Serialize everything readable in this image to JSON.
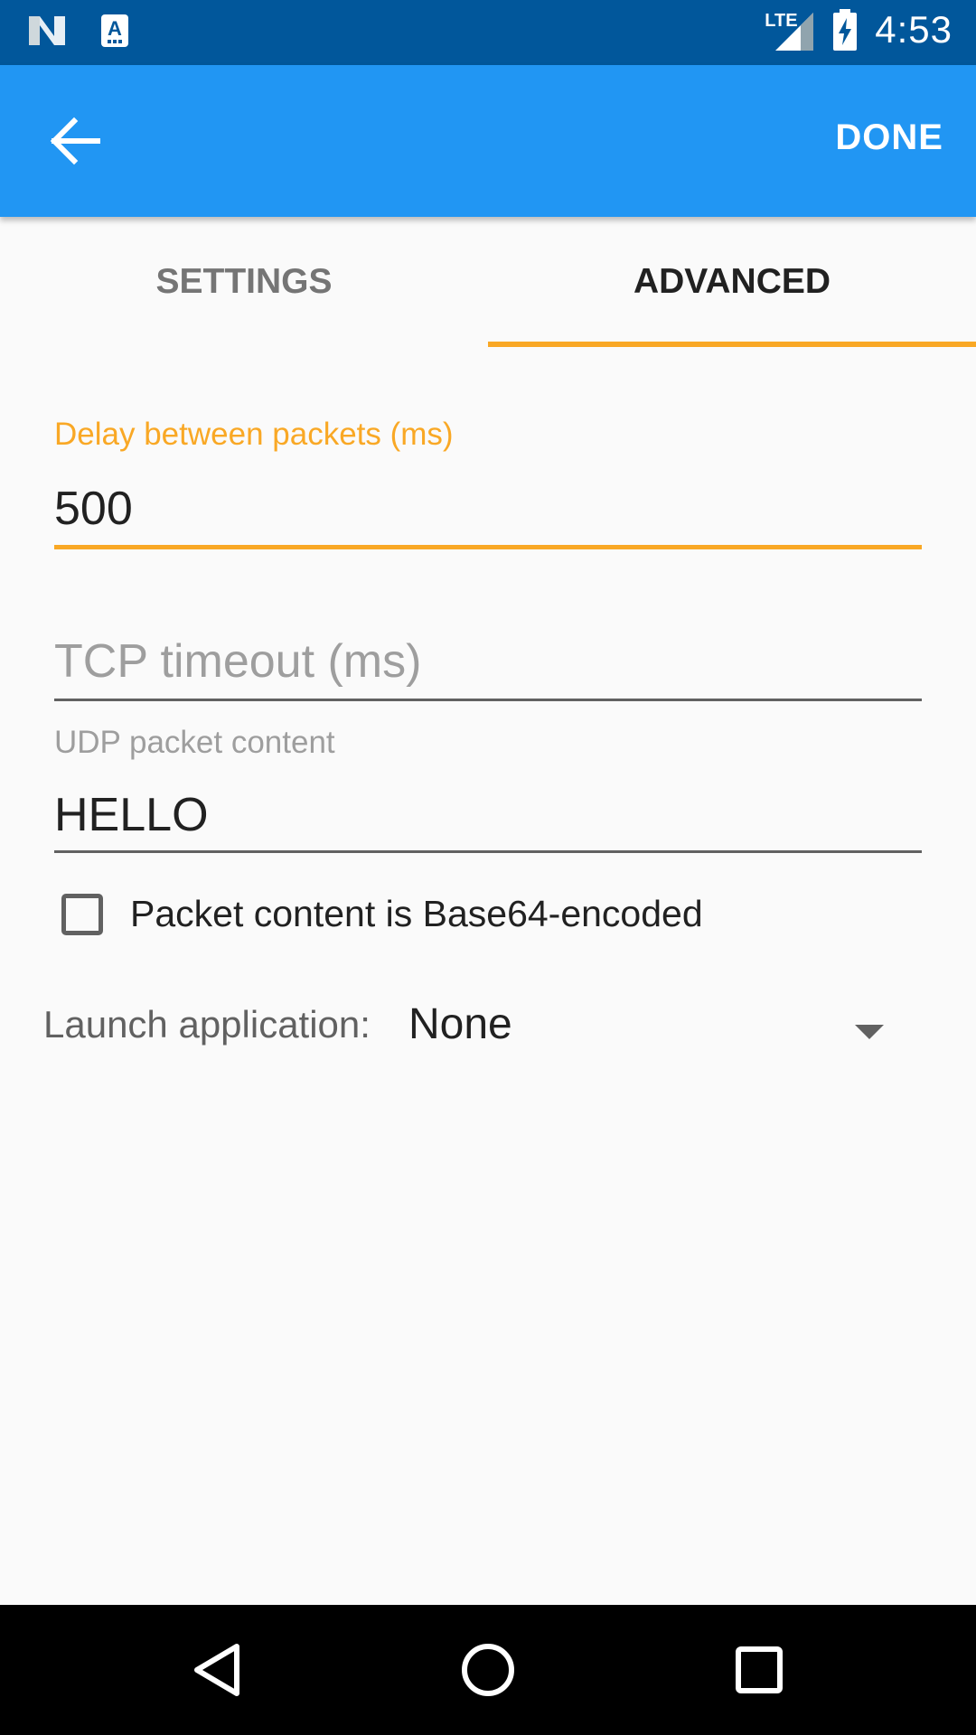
{
  "status_bar": {
    "time": "4:53",
    "network_label": "LTE",
    "icons": [
      "notification-n-icon",
      "notification-a-icon",
      "signal-icon",
      "battery-charging-icon"
    ]
  },
  "app_bar": {
    "back_icon": "arrow-back-icon",
    "done_label": "DONE",
    "color": "#2196f3"
  },
  "tabs": {
    "items": [
      {
        "label": "SETTINGS",
        "selected": false
      },
      {
        "label": "ADVANCED",
        "selected": true
      }
    ],
    "indicator_color": "#f9a825"
  },
  "form": {
    "delay": {
      "label": "Delay between packets (ms)",
      "value": "500",
      "focused": true
    },
    "tcp_timeout": {
      "placeholder": "TCP timeout (ms)",
      "value": ""
    },
    "udp_content": {
      "label": "UDP packet content",
      "value": "HELLO"
    },
    "base64_checkbox": {
      "label": "Packet content is Base64-encoded",
      "checked": false
    },
    "launch_app": {
      "label": "Launch application:",
      "selected": "None"
    }
  },
  "nav_bar": {
    "icons": [
      "back-triangle-icon",
      "home-circle-icon",
      "recents-square-icon"
    ]
  },
  "colors": {
    "accent": "#f9a825",
    "primary": "#2196f3",
    "primary_dark": "#01579b"
  }
}
